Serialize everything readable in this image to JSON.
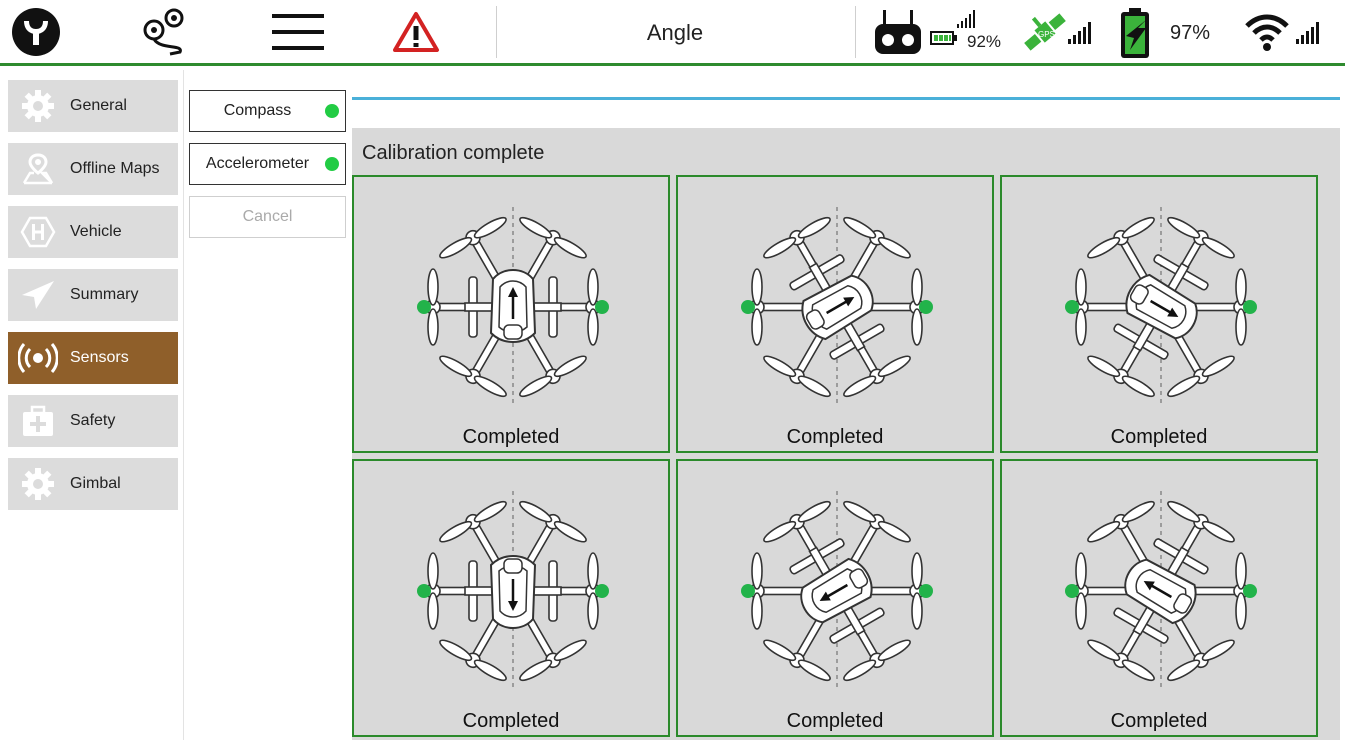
{
  "topbar": {
    "title": "Angle",
    "remote_battery": "92%",
    "vehicle_battery": "97%",
    "icons": [
      "app-logo-icon",
      "route-pin-icon",
      "menu-icon",
      "warning-icon",
      "remote-controller-icon",
      "battery-icon",
      "signal-icon",
      "gps-satellite-icon",
      "flight-battery-icon",
      "wifi-icon"
    ]
  },
  "sidebar": {
    "items": [
      {
        "label": "General",
        "icon": "gear-icon"
      },
      {
        "label": "Offline Maps",
        "icon": "map-icon"
      },
      {
        "label": "Vehicle",
        "icon": "vehicle-icon"
      },
      {
        "label": "Summary",
        "icon": "paper-plane-icon"
      },
      {
        "label": "Sensors",
        "icon": "sensor-icon"
      },
      {
        "label": "Safety",
        "icon": "first-aid-icon"
      },
      {
        "label": "Gimbal",
        "icon": "gear-icon"
      }
    ],
    "active": "Sensors"
  },
  "submenu": {
    "compass": "Compass",
    "accelerometer": "Accelerometer",
    "cancel": "Cancel"
  },
  "calibration": {
    "title": "Calibration complete",
    "cells": [
      {
        "status": "Completed",
        "orientation": "nose-up"
      },
      {
        "status": "Completed",
        "orientation": "tilt-right-up"
      },
      {
        "status": "Completed",
        "orientation": "tilt-right-down"
      },
      {
        "status": "Completed",
        "orientation": "nose-down"
      },
      {
        "status": "Completed",
        "orientation": "tilt-left-down"
      },
      {
        "status": "Completed",
        "orientation": "tilt-left-up"
      }
    ]
  },
  "colors": {
    "accent_green": "#2e8b2e",
    "active_item": "#8f5f2a",
    "progress_blue": "#4ab0d9",
    "status_dot": "#22cc44"
  }
}
